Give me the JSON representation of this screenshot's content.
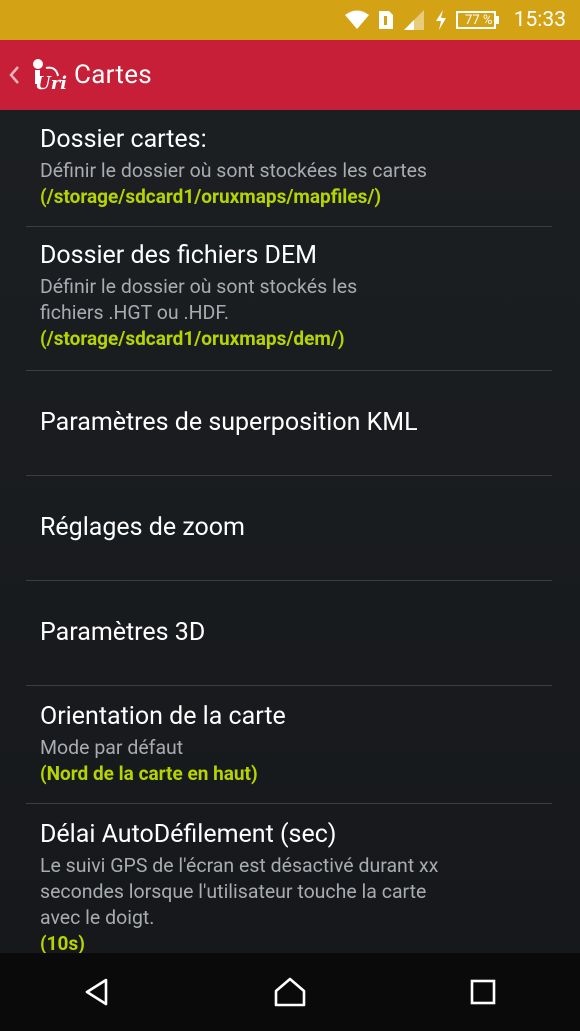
{
  "status_bar": {
    "time": "15:33",
    "battery_percent": "77 %",
    "icons": [
      "wifi-icon",
      "sim-icon",
      "signal-icon",
      "charging-icon",
      "battery-icon"
    ]
  },
  "app_bar": {
    "title": "Cartes",
    "logo_text": "Uri",
    "icons": [
      "back-chevron-icon",
      "app-logo-icon"
    ]
  },
  "preferences": [
    {
      "title": "Dossier cartes:",
      "summary": "Définir le dossier où sont stockées les cartes",
      "value": "(/storage/sdcard1/oruxmaps/mapfiles/)"
    },
    {
      "title": "Dossier des fichiers DEM",
      "summary_lines": [
        "Définir le dossier où sont stockés les",
        "fichiers .HGT ou .HDF."
      ],
      "value": "(/storage/sdcard1/oruxmaps/dem/)"
    },
    {
      "title": "Paramètres de superposition KML"
    },
    {
      "title": "Réglages de zoom"
    },
    {
      "title": "Paramètres 3D"
    },
    {
      "title": "Orientation de la carte",
      "summary": "Mode par défaut",
      "value": "(Nord de la carte en haut)"
    },
    {
      "title": "Délai AutoDéfilement (sec)",
      "summary_lines": [
        "Le suivi GPS de l'écran est désactivé durant xx",
        "secondes lorsque l'utilisateur touche la carte",
        "avec le doigt."
      ],
      "value": "(10s)"
    }
  ],
  "nav_bar": {
    "icons": [
      "back-triangle-icon",
      "home-icon",
      "recents-icon"
    ]
  },
  "colors": {
    "status_bar": "#d4a215",
    "app_bar": "#c71f37",
    "background": "#1b1e21",
    "value_accent": "#b5d400",
    "summary_text": "#a8abaf"
  }
}
